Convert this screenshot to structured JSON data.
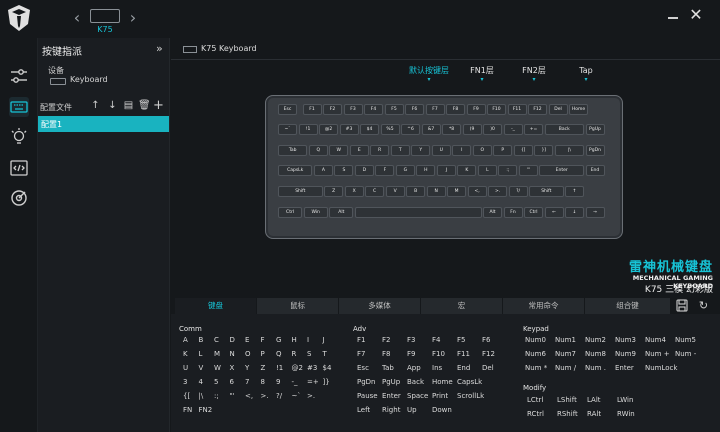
{
  "topbar": {
    "model": "K75",
    "prev_icon": "chevron-left-icon",
    "next_icon": "chevron-right-icon",
    "minimize_icon": "minimize-icon",
    "close_symbol": "✕"
  },
  "rail": {
    "icons": [
      "sliders-icon",
      "keyboard-icon",
      "lightbulb-icon",
      "code-icon",
      "target-icon"
    ]
  },
  "side": {
    "title": "按键指派",
    "collapse_symbol": "»",
    "device_label": "设备",
    "device_name": "Keyboard",
    "profiles_label": "配置文件",
    "profile_tools": [
      "↑",
      "↓",
      "▤",
      "🗑",
      "+"
    ],
    "profiles": [
      "配置1"
    ]
  },
  "main": {
    "keyboard_tag": "K75 Keyboard",
    "layers": [
      {
        "label": "默认按键层",
        "active": true
      },
      {
        "label": "FN1层",
        "active": false
      },
      {
        "label": "FN2层",
        "active": false
      },
      {
        "label": "Tap",
        "active": false
      }
    ],
    "brand": {
      "line1": "雷神机械键盘",
      "line2": "MECHANICAL GAMING KEYBOARD",
      "line3": "K75 三模 幻彩版"
    },
    "tabs": [
      "键盘",
      "鼠标",
      "多媒体",
      "宏",
      "常用命令",
      "组合键"
    ],
    "groups": {
      "comm": {
        "title": "Comm",
        "rows": [
          [
            "A",
            "B",
            "C",
            "D",
            "E",
            "F",
            "G",
            "H",
            "I",
            "J"
          ],
          [
            "K",
            "L",
            "M",
            "N",
            "O",
            "P",
            "Q",
            "R",
            "S",
            "T"
          ],
          [
            "U",
            "V",
            "W",
            "X",
            "Y",
            "Z",
            "!1",
            "@2",
            "#3",
            "$4"
          ],
          [
            "3",
            "4",
            "5",
            "6",
            "7",
            "8",
            "9",
            "-_",
            "=+",
            "]}"
          ],
          [
            "{[",
            "|\\",
            ":;",
            "\"'",
            "<,",
            ">.",
            "?/",
            "~`",
            ">.",
            ""
          ],
          [
            "FN",
            "FN2"
          ]
        ]
      },
      "adv": {
        "title": "Adv",
        "rows": [
          [
            "F1",
            "F2",
            "F3",
            "F4",
            "F5",
            "F6"
          ],
          [
            "F7",
            "F8",
            "F9",
            "F10",
            "F11",
            "F12"
          ],
          [
            "Esc",
            "Tab",
            "App",
            "Ins",
            "End",
            "Del"
          ],
          [
            "PgDn",
            "PgUp",
            "Back",
            "Home",
            "CapsLk",
            ""
          ],
          [
            "Pause",
            "Enter",
            "Space",
            "Print",
            "ScrollLk",
            ""
          ],
          [
            "Left",
            "Right",
            "Up",
            "Down",
            "",
            ""
          ]
        ]
      },
      "keypad": {
        "title": "Keypad",
        "rows": [
          [
            "Num0",
            "Num1",
            "Num2",
            "Num3",
            "Num4",
            "Num5"
          ],
          [
            "Num6",
            "Num7",
            "Num8",
            "Num9",
            "Num +",
            "Num -"
          ],
          [
            "Num *",
            "Num /",
            "Num .",
            "Enter",
            "NumLock",
            ""
          ]
        ]
      },
      "modify": {
        "title": "Modify",
        "rows": [
          [
            "LCtrl",
            "LShift",
            "LAlt",
            "LWin"
          ],
          [
            "RCtrl",
            "RShift",
            "RAlt",
            "RWin"
          ]
        ]
      }
    },
    "keyboard_rows": [
      [
        "Esc",
        "F1",
        "F2",
        "F3",
        "F4",
        "F5",
        "F6",
        "F7",
        "F8",
        "F9",
        "F10",
        "F11",
        "F12",
        "Del",
        "Home"
      ],
      [
        "~`",
        "!1",
        "@2",
        "#3",
        "$4",
        "%5",
        "^6",
        "&7",
        "*8",
        "(9",
        ")0",
        "-_",
        "+=",
        "Back",
        "PgUp"
      ],
      [
        "Tab",
        "Q",
        "W",
        "E",
        "R",
        "T",
        "Y",
        "U",
        "I",
        "O",
        "P",
        "{[",
        "}]",
        "|\\",
        "PgDn"
      ],
      [
        "CapsLk",
        "A",
        "S",
        "D",
        "F",
        "G",
        "H",
        "J",
        "K",
        "L",
        ":;",
        "\"'",
        "Enter",
        "End"
      ],
      [
        "Shift",
        "Z",
        "X",
        "C",
        "V",
        "B",
        "N",
        "M",
        "<,",
        ">.",
        "?/",
        "Shift",
        "↑"
      ],
      [
        "Ctrl",
        "Win",
        "Alt",
        "",
        "Alt",
        "Fn",
        "Ctrl",
        "←",
        "↓",
        "→"
      ]
    ]
  }
}
